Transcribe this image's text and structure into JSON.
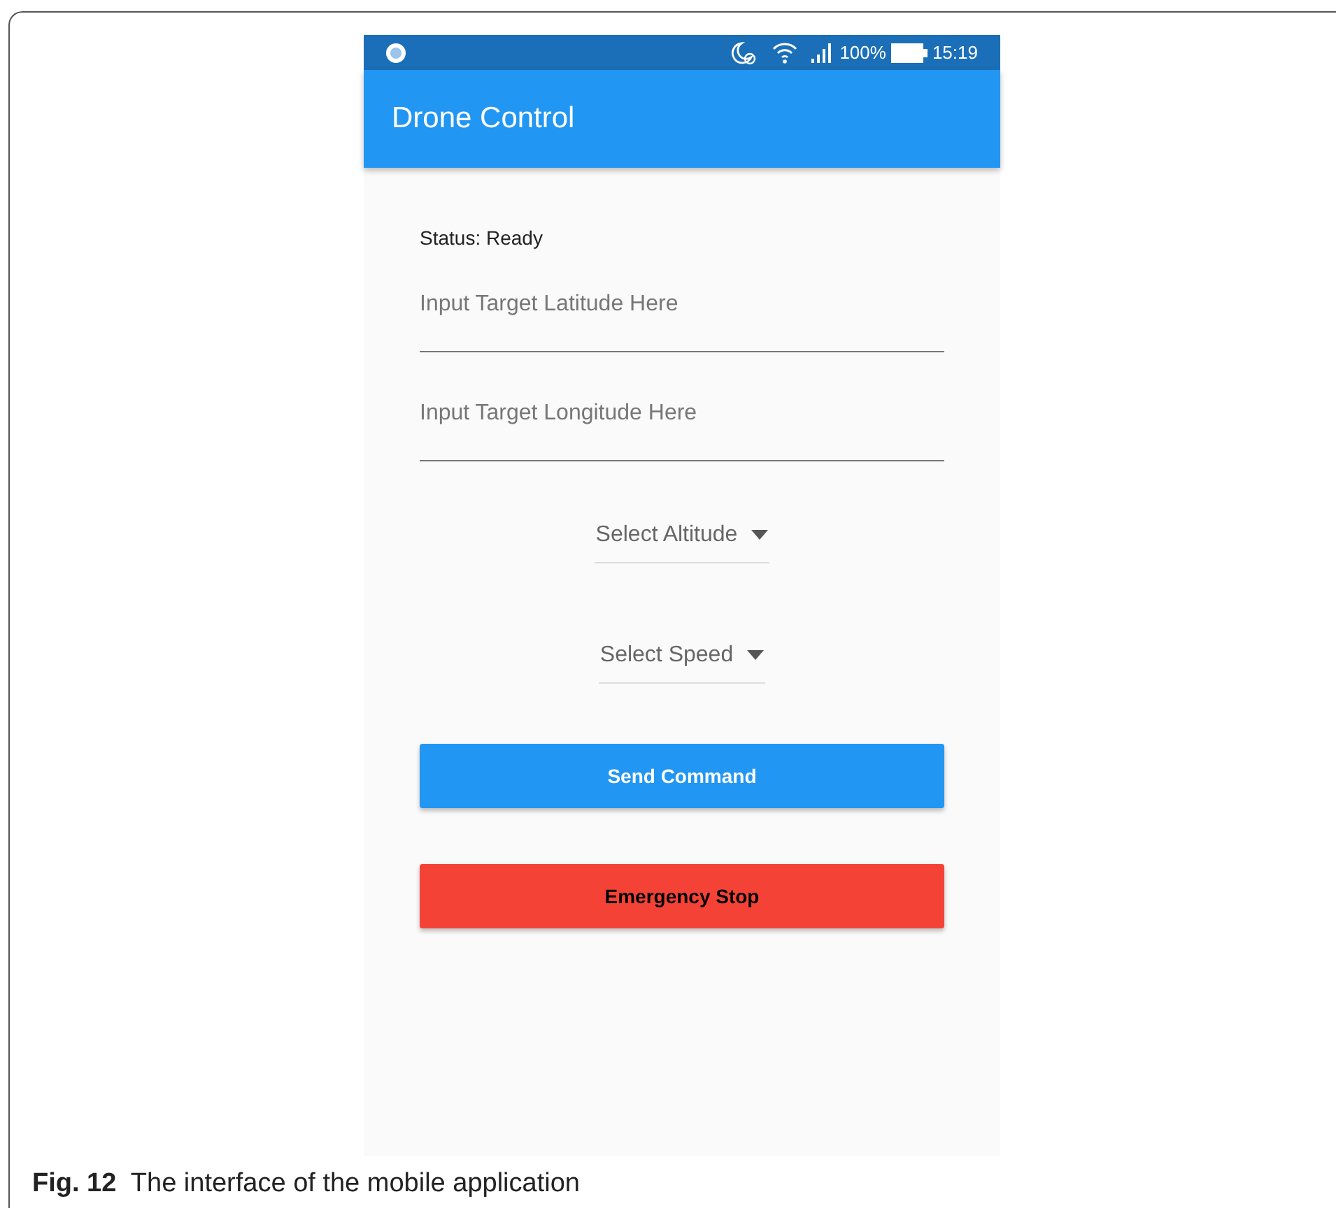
{
  "status_bar": {
    "battery": "100%",
    "time": "15:19"
  },
  "app_bar": {
    "title": "Drone Control"
  },
  "status_label": "Status: Ready",
  "fields": [
    {
      "placeholder": "Input Target Latitude Here"
    },
    {
      "placeholder": "Input Target Longitude Here"
    }
  ],
  "dropdowns": [
    {
      "label": "Select Altitude"
    },
    {
      "label": "Select Speed"
    }
  ],
  "buttons": [
    {
      "label": "Send Command",
      "kind": "primary"
    },
    {
      "label": "Emergency Stop",
      "kind": "danger"
    }
  ],
  "caption": "**Fig. 12**  The interface of the mobile application"
}
